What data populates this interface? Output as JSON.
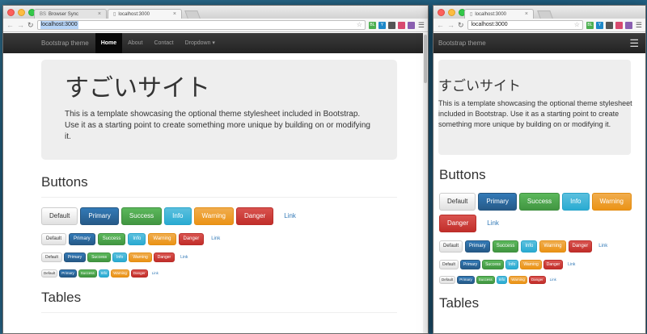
{
  "left_window": {
    "tabs": [
      {
        "icon": "BS",
        "label": "Browser Sync"
      },
      {
        "label": "localhost:3000"
      }
    ],
    "url": "localhost:3000",
    "navbar": {
      "brand": "Bootstrap theme",
      "links": [
        "Home",
        "About",
        "Contact",
        "Dropdown ▾"
      ]
    },
    "jumbotron": {
      "heading": "すごいサイト",
      "text": "This is a template showcasing the optional theme stylesheet included in Bootstrap. Use it as a starting point to create something more unique by building on or modifying it."
    },
    "buttons_heading": "Buttons",
    "tables_heading": "Tables"
  },
  "right_window": {
    "tabs": [
      {
        "label": "localhost:3000"
      }
    ],
    "url": "localhost:3000",
    "navbar": {
      "brand": "Bootstrap theme",
      "menu_icon": "☰"
    },
    "jumbotron": {
      "heading": "すごいサイト",
      "text": "This is a template showcasing the optional theme stylesheet included in Bootstrap. Use it as a starting point to create something more unique by building on or modifying it."
    },
    "buttons_heading": "Buttons",
    "tables_heading": "Tables"
  },
  "button_labels": {
    "default": "Default",
    "primary": "Primary",
    "success": "Success",
    "info": "Info",
    "warning": "Warning",
    "danger": "Danger",
    "link": "Link"
  },
  "extension_badges": [
    "BL",
    "Y",
    "",
    "",
    "",
    ""
  ],
  "colors": {
    "primary": "#337ab7",
    "success": "#5cb85c",
    "info": "#5bc0de",
    "warning": "#f0ad4e",
    "danger": "#d9534f",
    "navbar": "#222222",
    "jumbotron": "#eeeeee"
  }
}
